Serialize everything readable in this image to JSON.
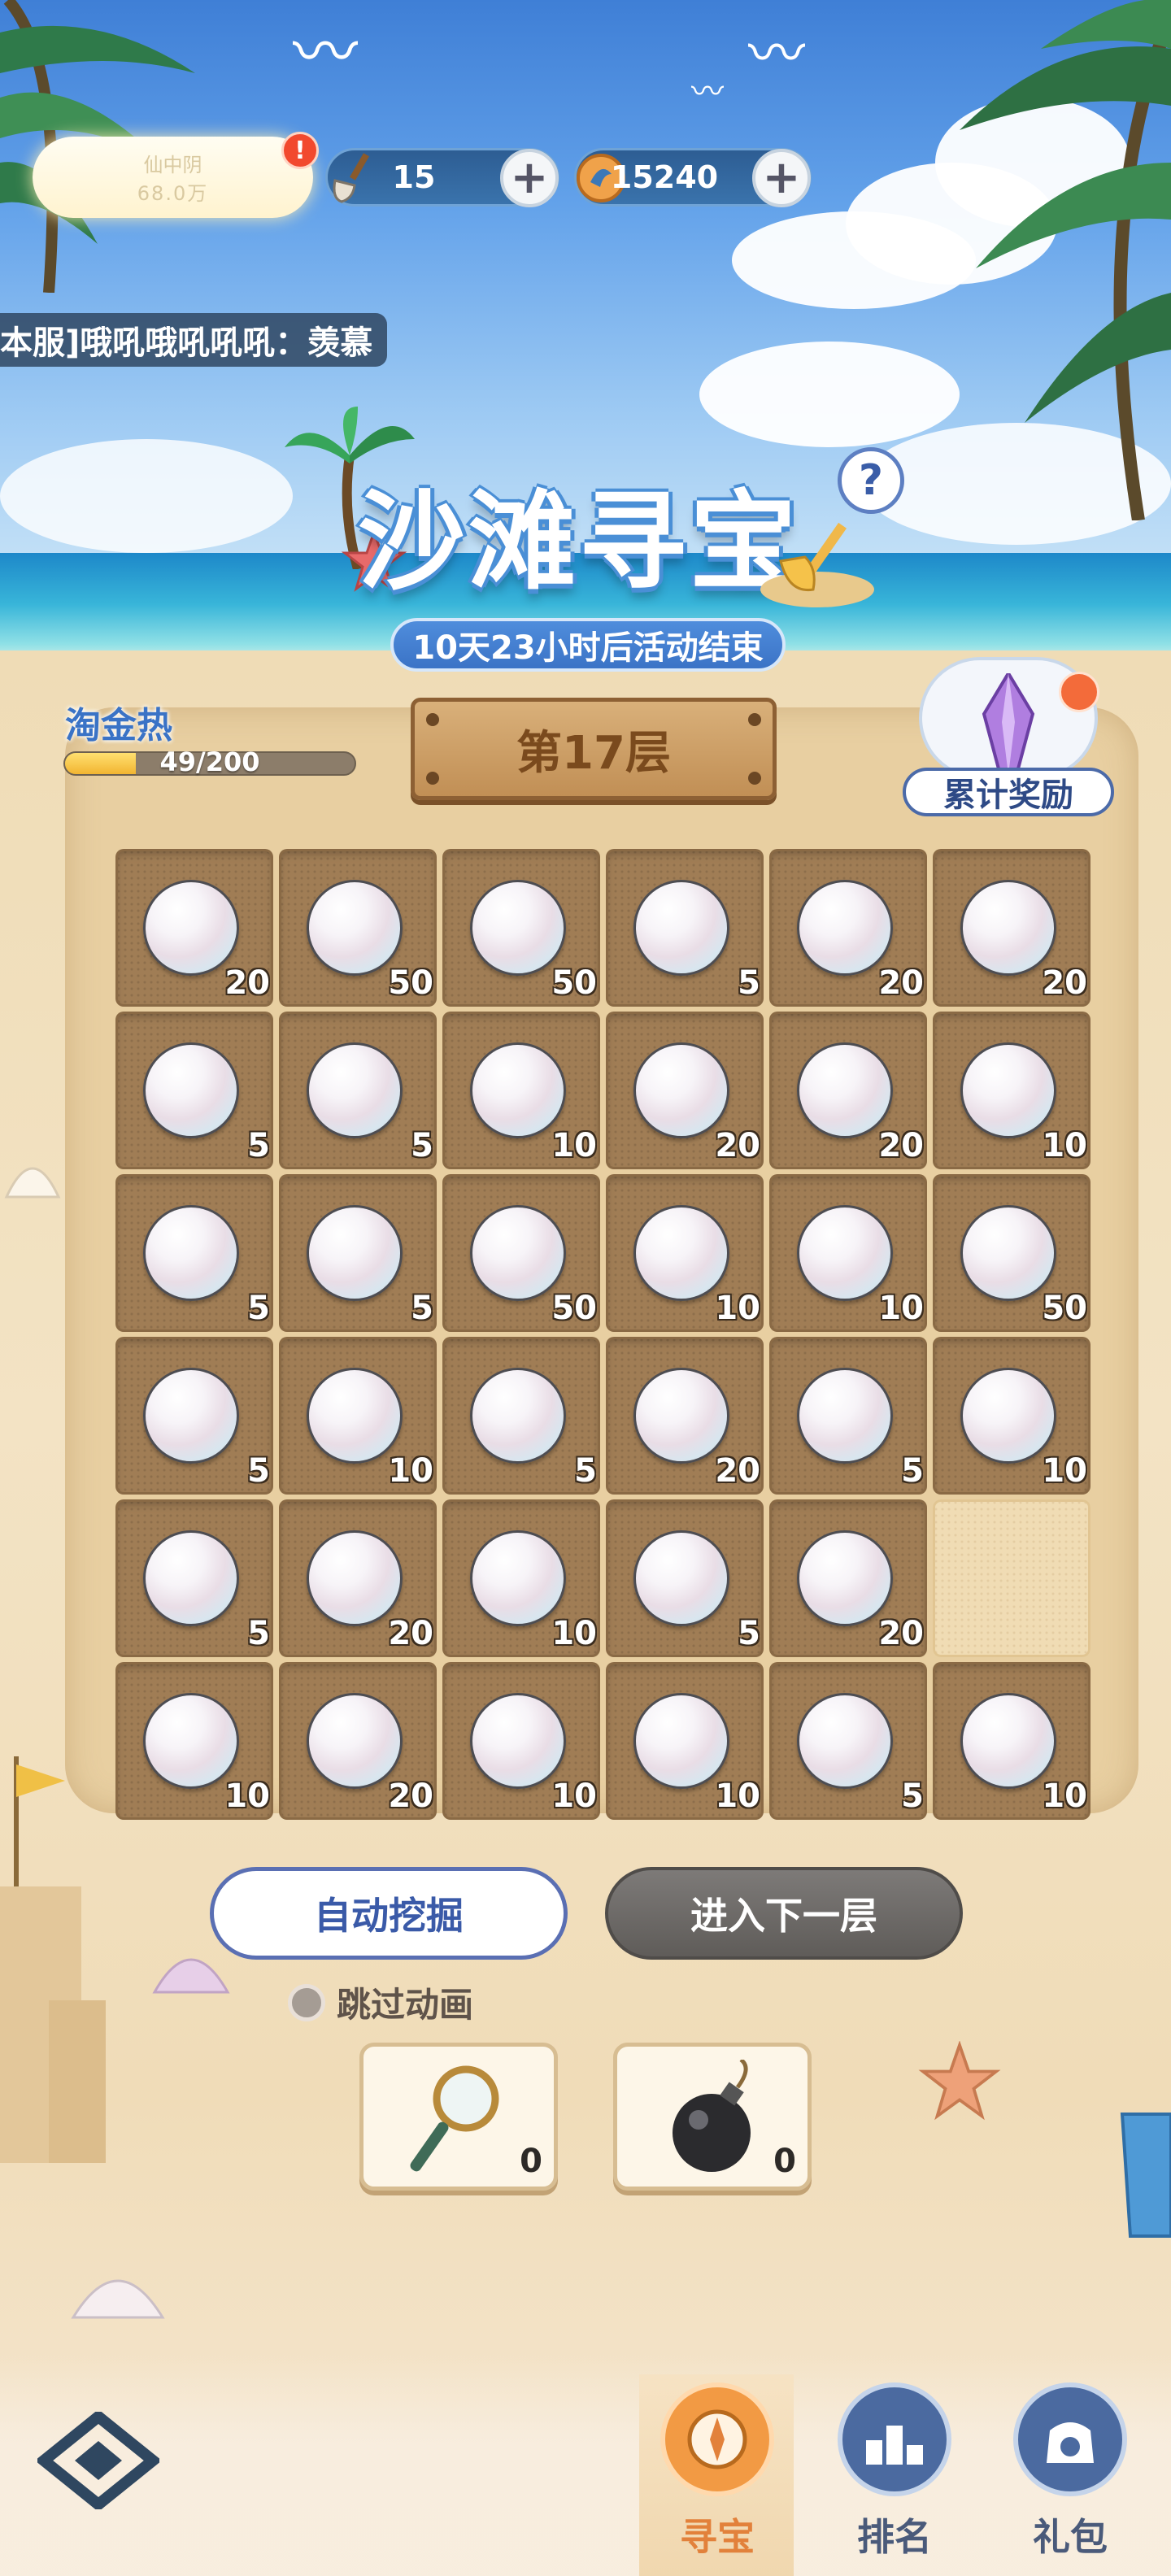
{
  "top_bar": {
    "profile": {
      "line1": "仙中阴",
      "line2": "68.0万"
    },
    "alert_mark": "!",
    "shovel": {
      "icon": "shovel-icon",
      "value": "15",
      "plus": "+"
    },
    "coin": {
      "icon": "shell-coin-icon",
      "value": "15240",
      "plus": "+"
    }
  },
  "chat": {
    "text": "本服]哦吼哦吼吼吼：羡慕"
  },
  "title": {
    "text": "沙滩寻宝",
    "countdown": "10天23小时后活动结束",
    "help": "?"
  },
  "heat": {
    "label": "淘金热",
    "current": 49,
    "max": 200,
    "text": "49/200"
  },
  "level": {
    "text": "第17层"
  },
  "reward": {
    "label": "累计奖励",
    "icon": "crystal-icon"
  },
  "grid": {
    "rows": [
      [
        {
          "value": "20",
          "dug": false
        },
        {
          "value": "50",
          "dug": false
        },
        {
          "value": "50",
          "dug": false
        },
        {
          "value": "5",
          "dug": false
        },
        {
          "value": "20",
          "dug": false
        },
        {
          "value": "20",
          "dug": false
        }
      ],
      [
        {
          "value": "5",
          "dug": false
        },
        {
          "value": "5",
          "dug": false
        },
        {
          "value": "10",
          "dug": false
        },
        {
          "value": "20",
          "dug": false
        },
        {
          "value": "20",
          "dug": false
        },
        {
          "value": "10",
          "dug": false
        }
      ],
      [
        {
          "value": "5",
          "dug": false
        },
        {
          "value": "5",
          "dug": false
        },
        {
          "value": "50",
          "dug": false
        },
        {
          "value": "10",
          "dug": false
        },
        {
          "value": "10",
          "dug": false
        },
        {
          "value": "50",
          "dug": false
        }
      ],
      [
        {
          "value": "5",
          "dug": false
        },
        {
          "value": "10",
          "dug": false
        },
        {
          "value": "5",
          "dug": false
        },
        {
          "value": "20",
          "dug": false
        },
        {
          "value": "5",
          "dug": false
        },
        {
          "value": "10",
          "dug": false
        }
      ],
      [
        {
          "value": "5",
          "dug": false
        },
        {
          "value": "20",
          "dug": false
        },
        {
          "value": "10",
          "dug": false
        },
        {
          "value": "5",
          "dug": false
        },
        {
          "value": "20",
          "dug": false
        },
        {
          "value": "",
          "dug": true
        }
      ],
      [
        {
          "value": "10",
          "dug": false
        },
        {
          "value": "20",
          "dug": false
        },
        {
          "value": "10",
          "dug": false
        },
        {
          "value": "10",
          "dug": false
        },
        {
          "value": "5",
          "dug": false
        },
        {
          "value": "10",
          "dug": false
        }
      ]
    ]
  },
  "actions": {
    "auto_dig": "自动挖掘",
    "next_level": "进入下一层",
    "skip_animation": "跳过动画"
  },
  "tools": [
    {
      "icon": "magnifier-icon",
      "count": "0"
    },
    {
      "icon": "bomb-icon",
      "count": "0"
    }
  ],
  "nav": {
    "items": [
      {
        "label": "寻宝",
        "icon": "compass-icon",
        "active": true
      },
      {
        "label": "排名",
        "icon": "ranking-icon",
        "active": false
      },
      {
        "label": "礼包",
        "icon": "gift-bag-icon",
        "active": false
      }
    ],
    "home_icon": "home-logo-icon"
  },
  "colors": {
    "accent_blue": "#3a73c6",
    "active_orange": "#e2813b",
    "tile_sand": "#a07d55",
    "alert_red": "#f2492e"
  }
}
